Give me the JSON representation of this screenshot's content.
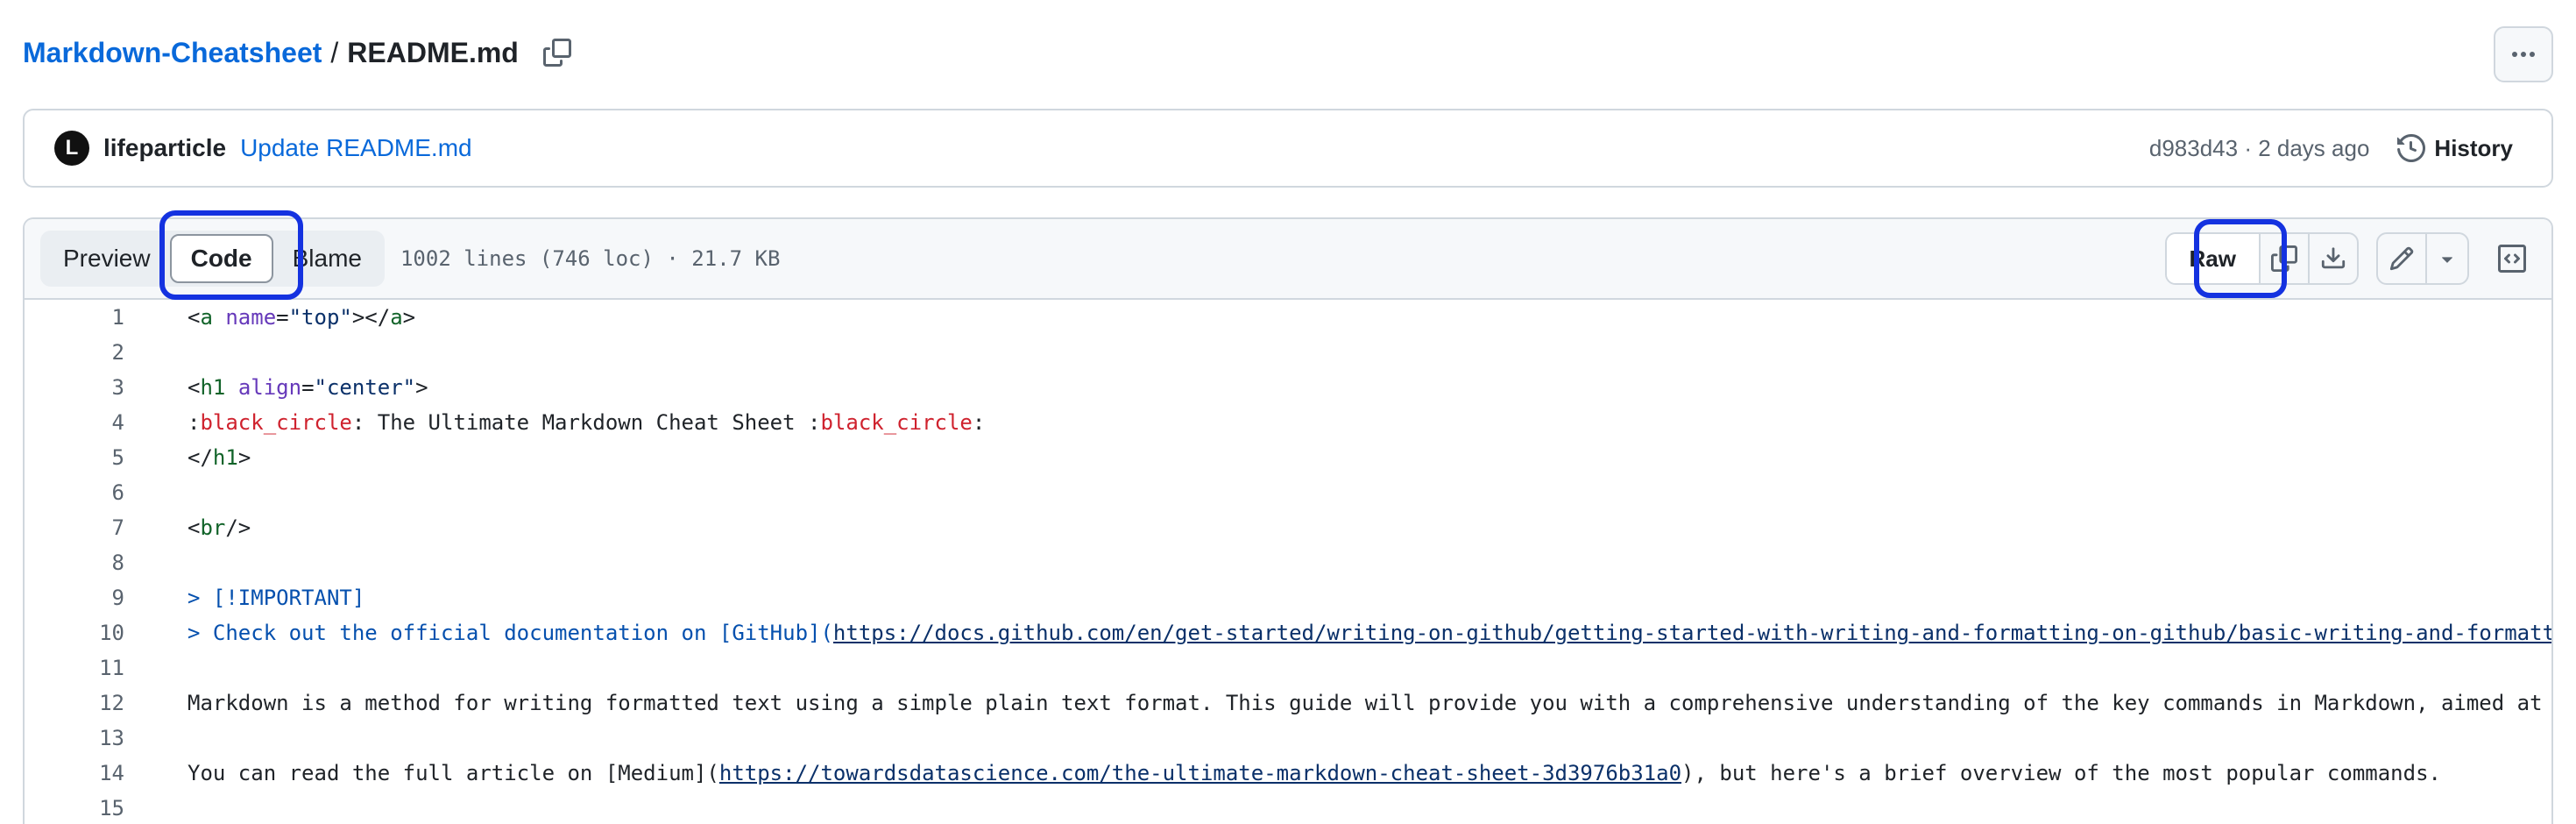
{
  "breadcrumb": {
    "repo": "Markdown-Cheatsheet",
    "separator": "/",
    "file": "README.md"
  },
  "commit": {
    "avatar_letter": "L",
    "author": "lifeparticle",
    "message": "Update README.md",
    "meta": "d983d43 · 2 days ago",
    "history_label": "History"
  },
  "file_header": {
    "tabs": [
      "Preview",
      "Code",
      "Blame"
    ],
    "active_tab": "Code",
    "info": "1002 lines (746 loc) · 21.7 KB",
    "raw_label": "Raw"
  },
  "code": {
    "line_numbers": [
      "1",
      "2",
      "3",
      "4",
      "5",
      "6",
      "7",
      "8",
      "9",
      "10",
      "11",
      "12",
      "13",
      "14",
      "15"
    ],
    "l1": {
      "a": "<",
      "b": "a",
      "c": " ",
      "d": "name",
      "e": "=",
      "f": "\"top\"",
      "g": "></",
      "h": "a",
      "i": ">"
    },
    "l3": {
      "a": "<",
      "b": "h1",
      "c": " ",
      "d": "align",
      "e": "=",
      "f": "\"center\"",
      "g": ">"
    },
    "l4": {
      "a": ":",
      "b": "black_circle",
      "c": ": The Ultimate Markdown Cheat Sheet :",
      "d": "black_circle",
      "e": ":"
    },
    "l5": {
      "a": "</",
      "b": "h1",
      "c": ">"
    },
    "l7": {
      "a": "<",
      "b": "br",
      "c": "/>"
    },
    "l9": "> [!IMPORTANT]",
    "l10": {
      "a": "> Check out the official documentation on [GitHub](",
      "b": "https://docs.github.com/en/get-started/writing-on-github/getting-started-with-writing-and-formatting-on-github/basic-writing-and-formatti"
    },
    "l12": "Markdown is a method for writing formatted text using a simple plain text format. This guide will provide you with a comprehensive understanding of the key commands in Markdown, aimed at c",
    "l14": {
      "a": "You can read the full article on [Medium](",
      "b": "https://towardsdatascience.com/the-ultimate-markdown-cheat-sheet-3d3976b31a0",
      "c": "), but here's a brief overview of the most popular commands."
    }
  },
  "colors": {
    "link": "#0969da",
    "highlight": "#1432e0",
    "border": "#d0d7de"
  }
}
